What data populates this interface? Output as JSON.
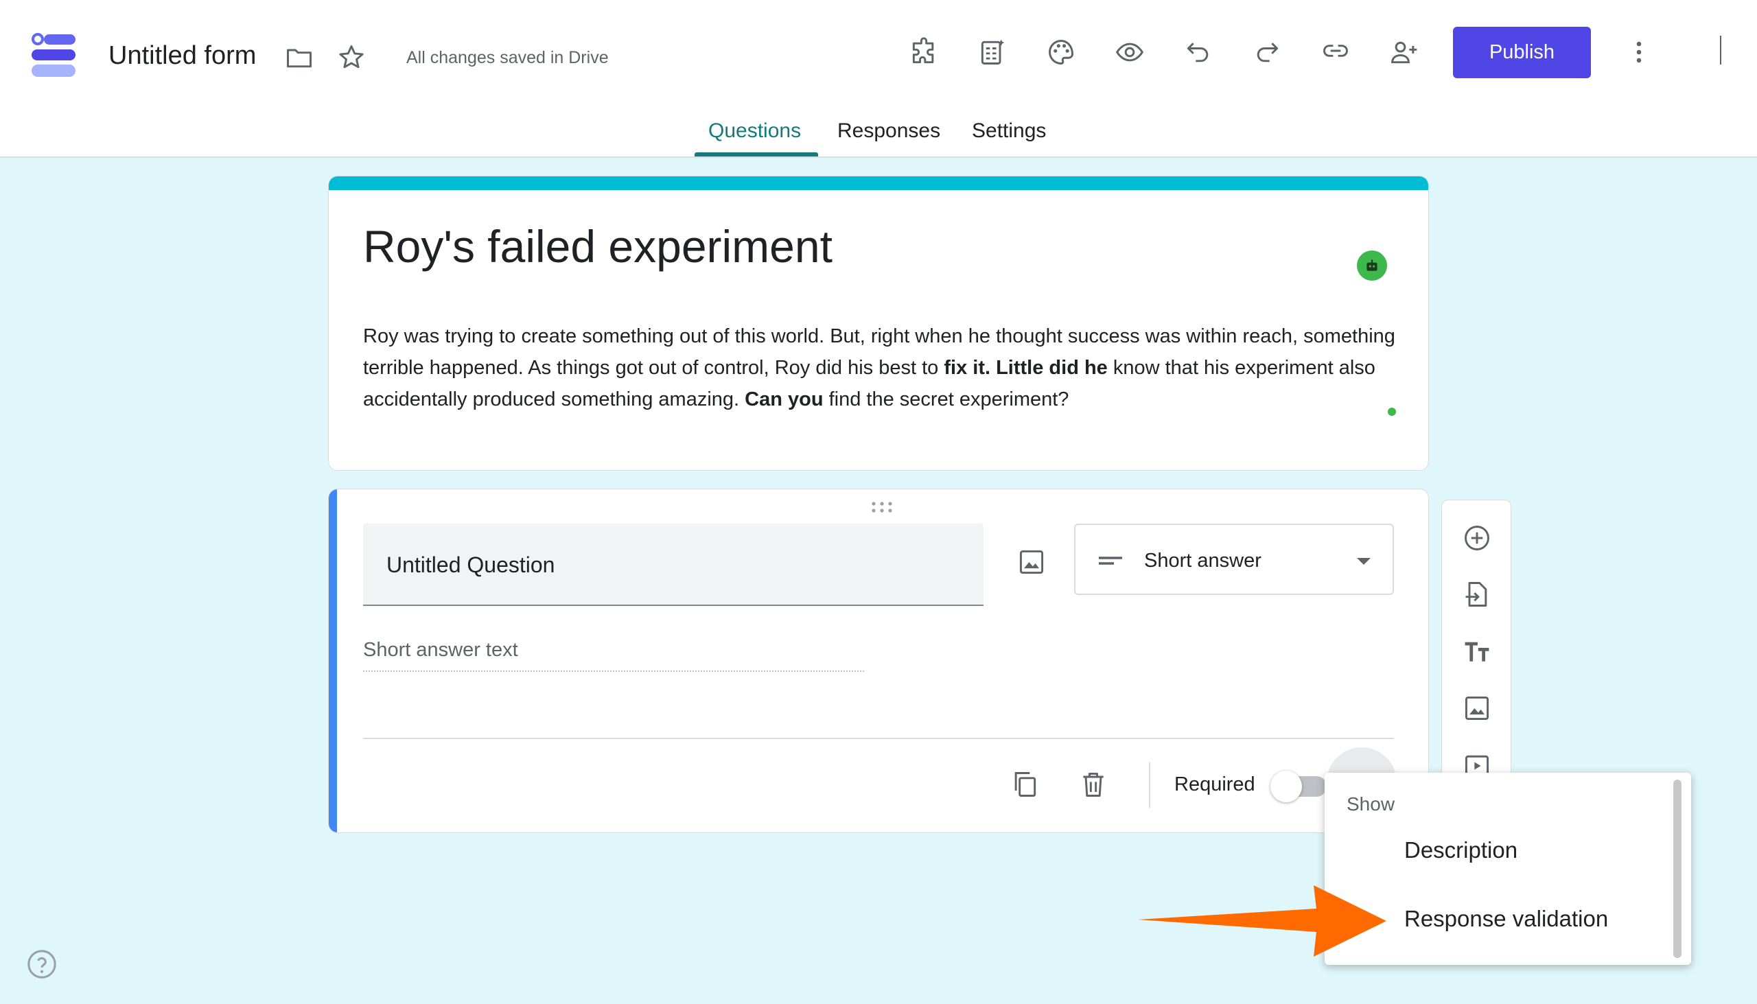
{
  "header": {
    "doc_title": "Untitled form",
    "save_status": "All changes saved in Drive",
    "publish_label": "Publish",
    "icons": [
      "forms-logo-icon",
      "folder-icon",
      "star-icon",
      "add-ons-icon",
      "quiz-icon",
      "palette-icon",
      "preview-eye-icon",
      "undo-icon",
      "redo-icon",
      "link-icon",
      "add-collaborator-icon",
      "more-vert-icon"
    ]
  },
  "tabs": [
    {
      "label": "Questions",
      "active": true
    },
    {
      "label": "Responses",
      "active": false
    },
    {
      "label": "Settings",
      "active": false
    }
  ],
  "form": {
    "title": "Roy's failed experiment",
    "description": {
      "p1": "Roy was trying to create something out of this world. But, right when he thought success was within reach, something terrible happened. As things got out of control, Roy did his best to ",
      "b1": "fix it. Little did he",
      "p2": " know that his experiment also accidentally produced something amazing. ",
      "b2": "Can you",
      "p3": " find the secret experiment?"
    }
  },
  "question": {
    "title": "Untitled Question",
    "type_label": "Short answer",
    "answer_placeholder": "Short answer text",
    "required_label": "Required",
    "required_on": false
  },
  "side_toolbar": [
    "add-question-icon",
    "import-questions-icon",
    "add-title-icon",
    "add-image-icon",
    "add-video-icon"
  ],
  "menu": {
    "header": "Show",
    "items": [
      {
        "label": "Description"
      },
      {
        "label": "Response validation"
      }
    ]
  },
  "colors": {
    "accent": "#137a7f",
    "publish": "#4f46e5",
    "theme_bar": "#00bcd4",
    "background": "#dff6fa",
    "question_bar": "#4285f4",
    "arrow": "#ff6a00"
  }
}
